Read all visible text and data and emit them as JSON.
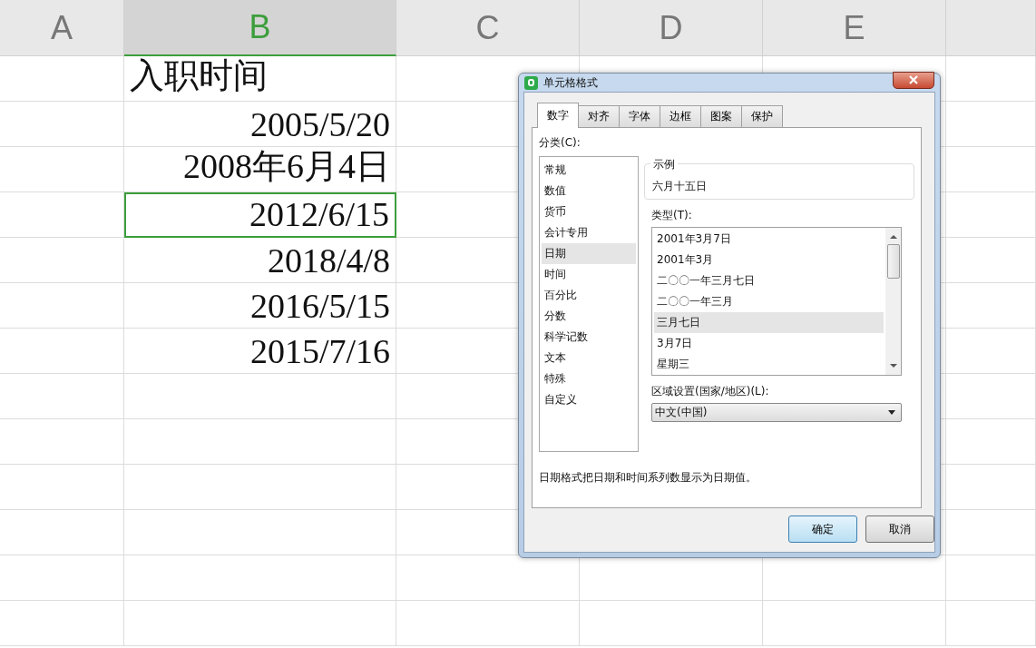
{
  "columns": [
    {
      "label": "A",
      "selected": false
    },
    {
      "label": "B",
      "selected": true
    },
    {
      "label": "C",
      "selected": false
    },
    {
      "label": "D",
      "selected": false
    },
    {
      "label": "E",
      "selected": false
    }
  ],
  "cells": [
    {
      "text": "入职时间",
      "kind": "text",
      "selected": false
    },
    {
      "text": "2005/5/20",
      "kind": "number",
      "selected": false
    },
    {
      "text": "2008年6月4日",
      "kind": "number",
      "selected": false
    },
    {
      "text": "2012/6/15",
      "kind": "number",
      "selected": true
    },
    {
      "text": "2018/4/8",
      "kind": "number",
      "selected": false
    },
    {
      "text": "2016/5/15",
      "kind": "number",
      "selected": false
    },
    {
      "text": "2015/7/16",
      "kind": "number",
      "selected": false
    }
  ],
  "dialog": {
    "title": "单元格格式",
    "tabs": [
      {
        "label": "数字",
        "selected": true
      },
      {
        "label": "对齐",
        "selected": false
      },
      {
        "label": "字体",
        "selected": false
      },
      {
        "label": "边框",
        "selected": false
      },
      {
        "label": "图案",
        "selected": false
      },
      {
        "label": "保护",
        "selected": false
      }
    ],
    "category_label": "分类(C):",
    "categories": [
      {
        "label": "常规",
        "selected": false
      },
      {
        "label": "数值",
        "selected": false
      },
      {
        "label": "货币",
        "selected": false
      },
      {
        "label": "会计专用",
        "selected": false
      },
      {
        "label": "日期",
        "selected": true
      },
      {
        "label": "时间",
        "selected": false
      },
      {
        "label": "百分比",
        "selected": false
      },
      {
        "label": "分数",
        "selected": false
      },
      {
        "label": "科学记数",
        "selected": false
      },
      {
        "label": "文本",
        "selected": false
      },
      {
        "label": "特殊",
        "selected": false
      },
      {
        "label": "自定义",
        "selected": false
      }
    ],
    "sample": {
      "legend": "示例",
      "value": "六月十五日"
    },
    "type_label": "类型(T):",
    "types": [
      {
        "label": "2001年3月7日",
        "selected": false
      },
      {
        "label": "2001年3月",
        "selected": false
      },
      {
        "label": "二〇〇一年三月七日",
        "selected": false
      },
      {
        "label": "二〇〇一年三月",
        "selected": false
      },
      {
        "label": "三月七日",
        "selected": true
      },
      {
        "label": "3月7日",
        "selected": false
      },
      {
        "label": "星期三",
        "selected": false
      }
    ],
    "locale_label": "区域设置(国家/地区)(L):",
    "locale_value": "中文(中国)",
    "description": "日期格式把日期和时间系列数显示为日期值。",
    "buttons": [
      {
        "label": "确定",
        "kind": "default"
      },
      {
        "label": "取消",
        "kind": "normal"
      }
    ]
  }
}
